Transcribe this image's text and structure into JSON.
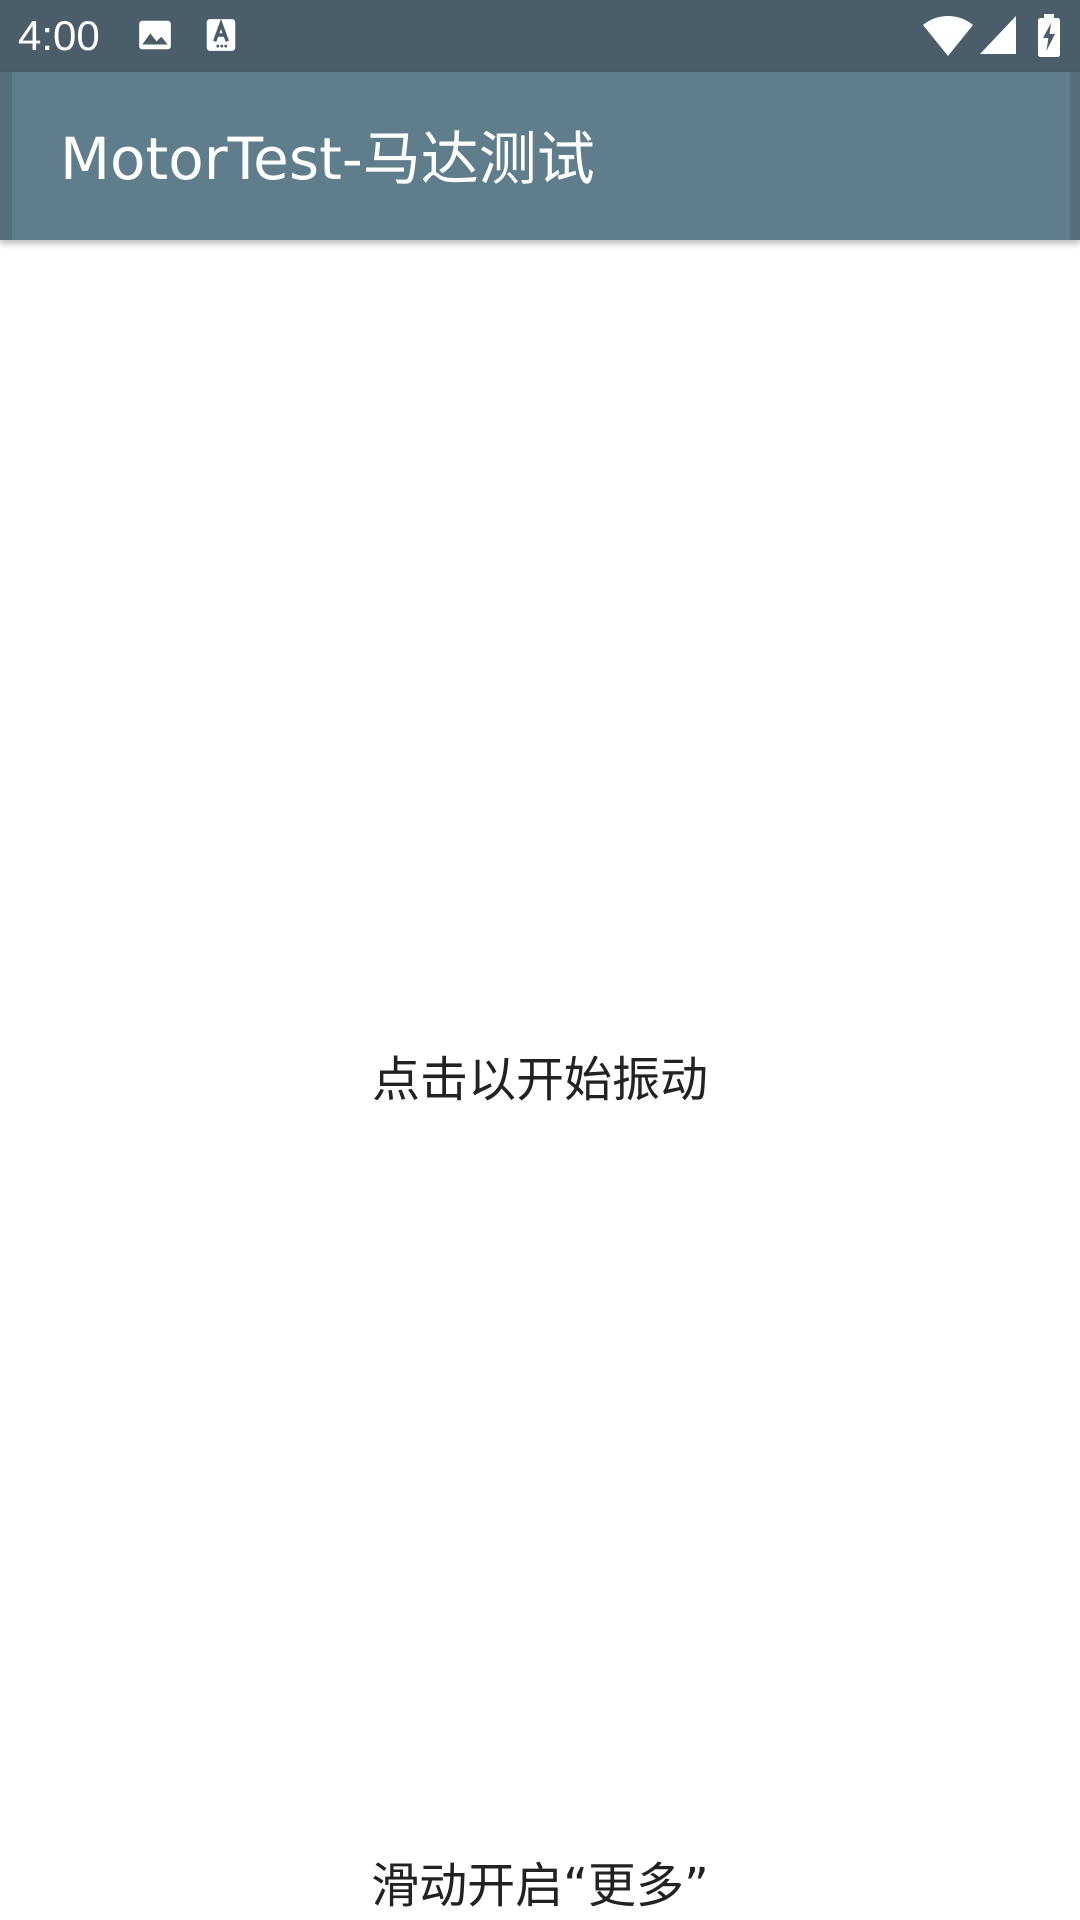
{
  "status_bar": {
    "time": "4:00",
    "icons": [
      "gallery-icon",
      "font-icon",
      "wifi-icon",
      "signal-icon",
      "battery-charging-icon"
    ],
    "background_color": "#4a5d69"
  },
  "app_bar": {
    "title": "MotorTest-马达测试",
    "background_color": "#607d8b"
  },
  "content": {
    "tap_label": "点击以开始振动",
    "swipe_label": "滑动开启“更多”"
  }
}
